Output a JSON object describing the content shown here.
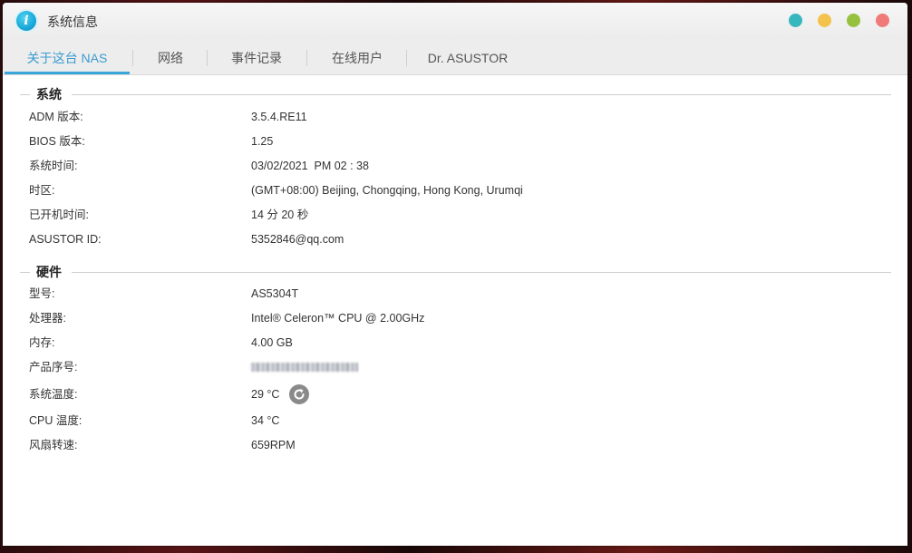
{
  "window": {
    "title": "系统信息",
    "icon": "info-icon",
    "icon_letter": "i",
    "controls": [
      {
        "name": "window-control-teal",
        "color": "#36b7be"
      },
      {
        "name": "window-control-yellow",
        "color": "#f4c34d"
      },
      {
        "name": "window-control-green",
        "color": "#96c13f"
      },
      {
        "name": "window-control-close",
        "color": "#f07a7a"
      }
    ]
  },
  "tabs": [
    {
      "label": "关于这台 NAS",
      "active": true
    },
    {
      "label": "网络",
      "active": false
    },
    {
      "label": "事件记录",
      "active": false
    },
    {
      "label": "在线用户",
      "active": false
    },
    {
      "label": "Dr. ASUSTOR",
      "active": false
    }
  ],
  "accent_color": "#3aa6dc",
  "system": {
    "title": "系统",
    "rows": [
      {
        "label": "ADM 版本:",
        "value": "3.5.4.RE11"
      },
      {
        "label": "BIOS 版本:",
        "value": "1.25"
      },
      {
        "label": "系统时间:",
        "value": "03/02/2021  PM 02 : 38"
      },
      {
        "label": "时区:",
        "value": "(GMT+08:00) Beijing, Chongqing, Hong Kong, Urumqi"
      },
      {
        "label": "已开机时间:",
        "value": "14 分 20 秒"
      },
      {
        "label": "ASUSTOR ID:",
        "value": "5352846@qq.com"
      }
    ]
  },
  "hardware": {
    "title": "硬件",
    "rows": [
      {
        "label": "型号:",
        "value": "AS5304T"
      },
      {
        "label": "处理器:",
        "value": "Intel® Celeron™ CPU @ 2.00GHz"
      },
      {
        "label": "内存:",
        "value": "4.00 GB"
      },
      {
        "label": "产品序号:",
        "value": ""
      },
      {
        "label": "系统温度:",
        "value": "29 °C"
      },
      {
        "label": "CPU 温度:",
        "value": "34 °C"
      },
      {
        "label": "风扇转速:",
        "value": "659RPM"
      }
    ]
  }
}
